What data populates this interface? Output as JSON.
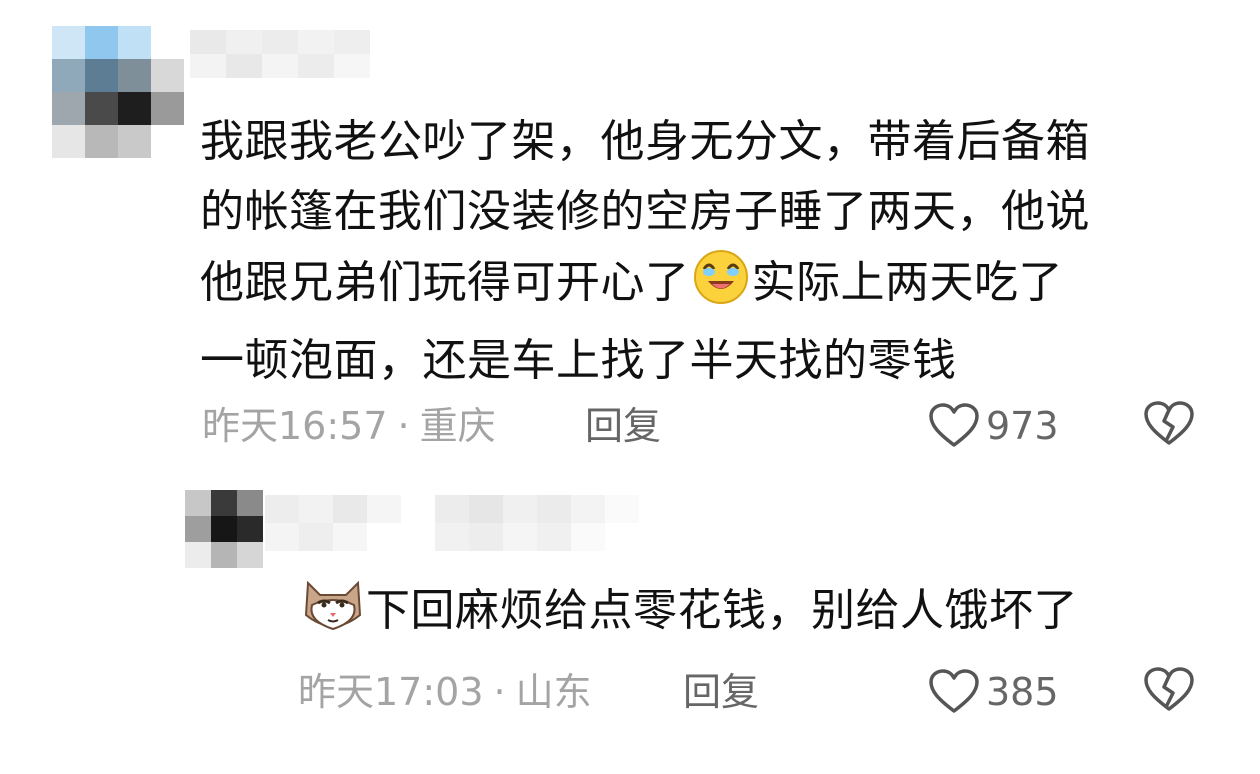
{
  "comments": [
    {
      "text_line_1": "我跟我老公吵了架，他身无分文，带着后备箱",
      "text_line_2": "的帐篷在我们没装修的空房子睡了两天，他说",
      "text_line_3a": "他跟兄弟们玩得可开心了",
      "text_line_3b": "实际上两天吃了",
      "text_line_4": "一顿泡面，还是车上找了半天找的零钱",
      "emoji_icon": "laugh-cry-emoji-icon",
      "time": "昨天16:57",
      "separator": "·",
      "location": "重庆",
      "reply_label": "回复",
      "like_count": "973"
    },
    {
      "text": "下回麻烦给点零花钱，别给人饿坏了",
      "emoji_icon": "cat-face-emoji-icon",
      "time": "昨天17:03",
      "separator": "·",
      "location": "山东",
      "reply_label": "回复",
      "like_count": "385"
    }
  ],
  "icons": {
    "like": "heart-outline-icon",
    "dislike": "broken-heart-icon"
  },
  "colors": {
    "text": "#111111",
    "meta": "#a4a4a4",
    "action": "#666666",
    "icon_stroke": "#555555"
  }
}
